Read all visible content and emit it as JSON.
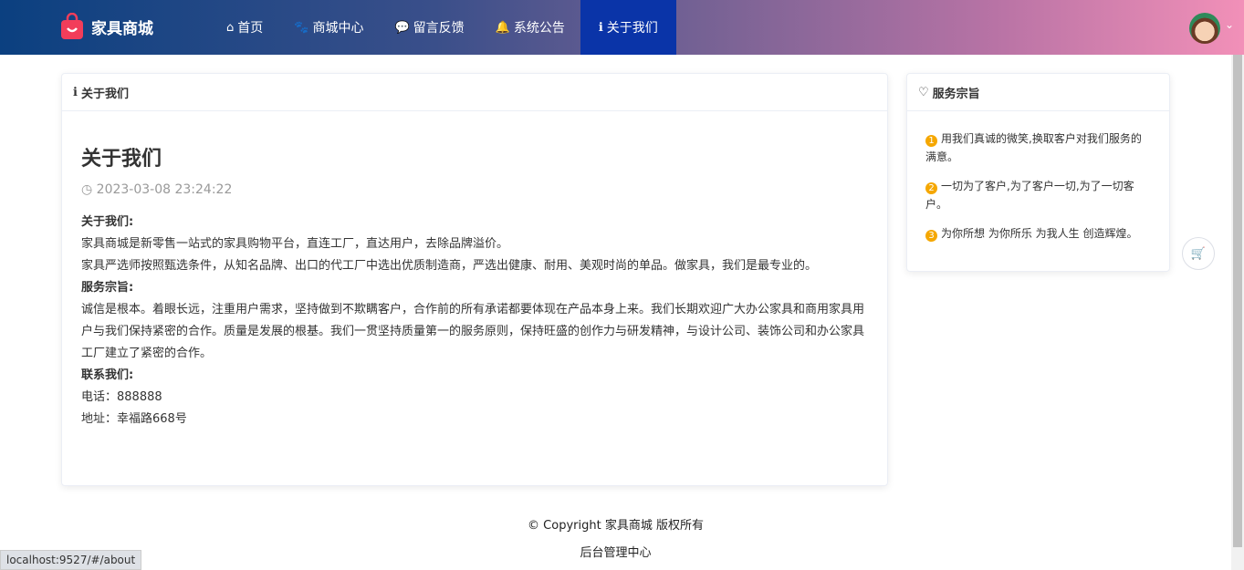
{
  "header": {
    "brand": "家具商城",
    "menu": [
      {
        "label": "首页",
        "icon": "home-icon"
      },
      {
        "label": "商城中心",
        "icon": "paw-icon"
      },
      {
        "label": "留言反馈",
        "icon": "chat-icon"
      },
      {
        "label": "系统公告",
        "icon": "bell-icon"
      },
      {
        "label": "关于我们",
        "icon": "info-icon",
        "active": true
      }
    ]
  },
  "main": {
    "card_title": "关于我们",
    "title": "关于我们",
    "date": "2023-03-08 23:24:22",
    "content": {
      "h1": "关于我们:",
      "p1": "家具商城是新零售一站式的家具购物平台，直连工厂，直达用户，去除品牌溢价。",
      "p2": "家具严选师按照甄选条件，从知名品牌、出口的代工厂中选出优质制造商，严选出健康、耐用、美观时尚的单品。做家具，我们是最专业的。",
      "h2": "服务宗旨:",
      "p3": "诚信是根本。着眼长远，注重用户需求，坚持做到不欺瞒客户，合作前的所有承诺都要体现在产品本身上来。我们长期欢迎广大办公家具和商用家具用户与我们保持紧密的合作。质量是发展的根基。我们一贯坚持质量第一的服务原则，保持旺盛的创作力与研发精神，与设计公司、装饰公司和办公家具工厂建立了紧密的合作。",
      "h3": "联系我们:",
      "phone": "电话：888888",
      "address": "地址：幸福路668号"
    }
  },
  "side": {
    "title": "服务宗旨",
    "items": [
      {
        "n": "1",
        "text": "用我们真诚的微笑,换取客户对我们服务的满意。"
      },
      {
        "n": "2",
        "text": "一切为了客户,为了客户一切,为了一切客户。"
      },
      {
        "n": "3",
        "text": "为你所想 为你所乐 为我人生 创造辉煌。"
      }
    ]
  },
  "footer": {
    "copyright": "© Copyright 家具商城 版权所有",
    "admin": "后台管理中心"
  },
  "status_url": "localhost:9527/#/about"
}
